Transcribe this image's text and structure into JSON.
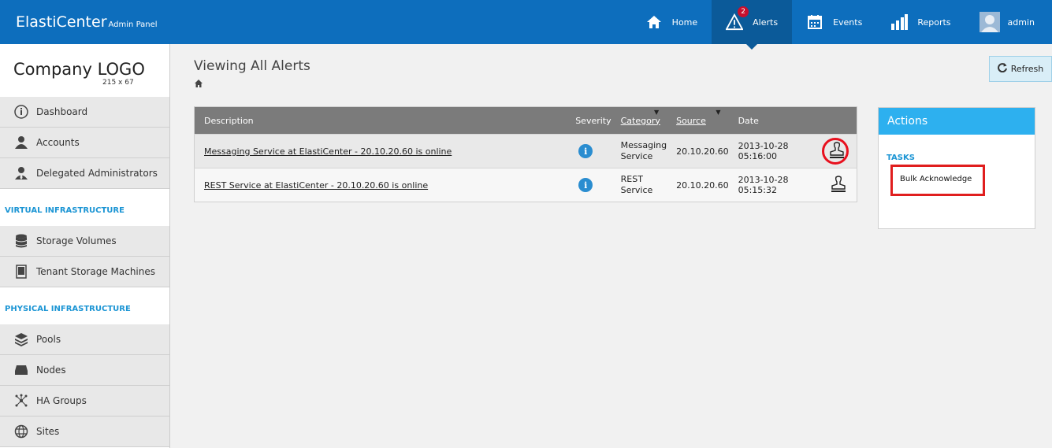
{
  "header": {
    "brand": "ElastiCenter",
    "brand_sub": "Admin Panel",
    "nav": [
      {
        "label": "Home",
        "icon": "home-icon"
      },
      {
        "label": "Alerts",
        "icon": "warning-icon",
        "badge": "2",
        "active": true
      },
      {
        "label": "Events",
        "icon": "calendar-icon"
      },
      {
        "label": "Reports",
        "icon": "bar-chart-icon"
      },
      {
        "label": "admin",
        "icon": "avatar"
      }
    ]
  },
  "sidebar": {
    "logo_title": "Company LOGO",
    "logo_size": "215 x 67",
    "items": [
      {
        "label": "Dashboard",
        "icon": "info-circle-icon"
      },
      {
        "label": "Accounts",
        "icon": "user-icon"
      },
      {
        "label": "Delegated Administrators",
        "icon": "user-tie-icon"
      }
    ],
    "section_virtual": "VIRTUAL INFRASTRUCTURE",
    "virtual_items": [
      {
        "label": "Storage Volumes",
        "icon": "database-icon"
      },
      {
        "label": "Tenant Storage Machines",
        "icon": "server-icon"
      }
    ],
    "section_physical": "PHYSICAL INFRASTRUCTURE",
    "physical_items": [
      {
        "label": "Pools",
        "icon": "layers-icon"
      },
      {
        "label": "Nodes",
        "icon": "drive-icon"
      },
      {
        "label": "HA Groups",
        "icon": "network-icon"
      },
      {
        "label": "Sites",
        "icon": "globe-icon"
      }
    ]
  },
  "main": {
    "title": "Viewing All Alerts",
    "refresh_label": "Refresh",
    "table": {
      "columns": [
        "Description",
        "Severity",
        "Category",
        "Source",
        "Date"
      ],
      "rows": [
        {
          "description": "Messaging Service at ElastiCenter - 20.10.20.60 is online",
          "category_line1": "Messaging",
          "category_line2": "Service",
          "source": "20.10.20.60",
          "date": "2013-10-28 05:16:00"
        },
        {
          "description": "REST Service at ElastiCenter - 20.10.20.60 is online",
          "category_line1": "REST",
          "category_line2": "Service",
          "source": "20.10.20.60",
          "date": "2013-10-28 05:15:32"
        }
      ]
    }
  },
  "actions": {
    "title": "Actions",
    "tasks_label": "TASKS",
    "bulk_label": "Bulk Acknowledge"
  },
  "colors": {
    "header_blue": "#0d6ebd",
    "actions_blue": "#2db0ef",
    "highlight_red": "#e01e1e"
  }
}
